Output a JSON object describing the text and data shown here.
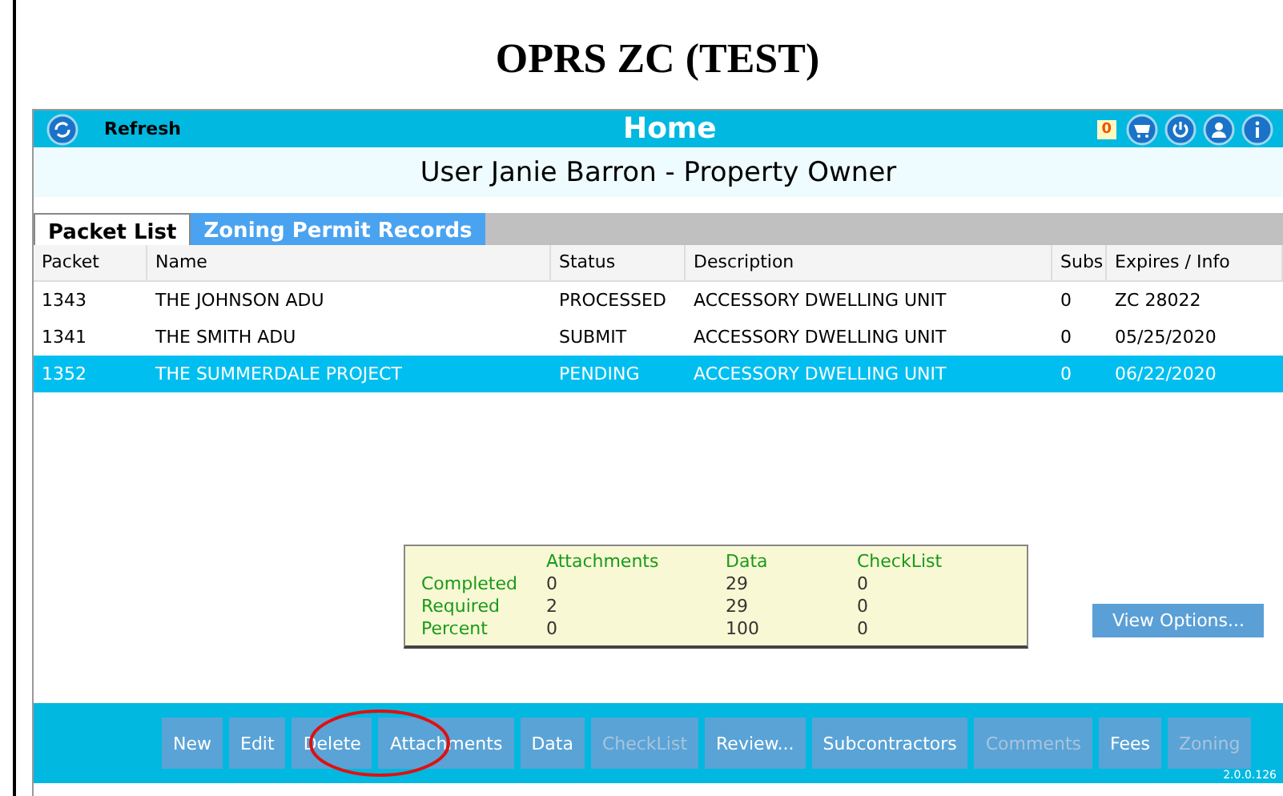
{
  "page_title": "OPRS ZC (TEST)",
  "toolbar": {
    "refresh_label": "Refresh",
    "title": "Home",
    "cart_count": "0"
  },
  "user_line": "User Janie Barron - Property Owner",
  "tabs": [
    {
      "label": "Packet List",
      "selected": true
    },
    {
      "label": "Zoning Permit Records",
      "selected": false
    }
  ],
  "table": {
    "columns": [
      "Packet",
      "Name",
      "Status",
      "Description",
      "Subs",
      "Expires / Info"
    ],
    "rows": [
      {
        "cells": [
          "1343",
          "THE JOHNSON ADU",
          "PROCESSED",
          "ACCESSORY DWELLING UNIT",
          "0",
          "ZC 28022"
        ],
        "selected": false
      },
      {
        "cells": [
          "1341",
          "THE SMITH ADU",
          "SUBMIT",
          "ACCESSORY DWELLING UNIT",
          "0",
          "05/25/2020"
        ],
        "selected": false
      },
      {
        "cells": [
          "1352",
          "THE SUMMERDALE PROJECT",
          "PENDING",
          "ACCESSORY DWELLING UNIT",
          "0",
          "06/22/2020"
        ],
        "selected": true
      }
    ]
  },
  "summary": {
    "columns": [
      "Attachments",
      "Data",
      "CheckList"
    ],
    "rows": [
      {
        "label": "Completed",
        "values": [
          "0",
          "29",
          "0"
        ]
      },
      {
        "label": "Required",
        "values": [
          "2",
          "29",
          "0"
        ]
      },
      {
        "label": "Percent",
        "values": [
          "0",
          "100",
          "0"
        ]
      }
    ]
  },
  "view_options": "View Options...",
  "buttons": [
    {
      "label": "New",
      "disabled": false
    },
    {
      "label": "Edit",
      "disabled": false
    },
    {
      "label": "Delete",
      "disabled": false
    },
    {
      "label": "Attachments",
      "disabled": false,
      "circled": true
    },
    {
      "label": "Data",
      "disabled": false
    },
    {
      "label": "CheckList",
      "disabled": true
    },
    {
      "label": "Review...",
      "disabled": false
    },
    {
      "label": "Subcontractors",
      "disabled": false
    },
    {
      "label": "Comments",
      "disabled": true
    },
    {
      "label": "Fees",
      "disabled": false
    },
    {
      "label": "Zoning",
      "disabled": true
    }
  ],
  "version": "2.0.0.126"
}
